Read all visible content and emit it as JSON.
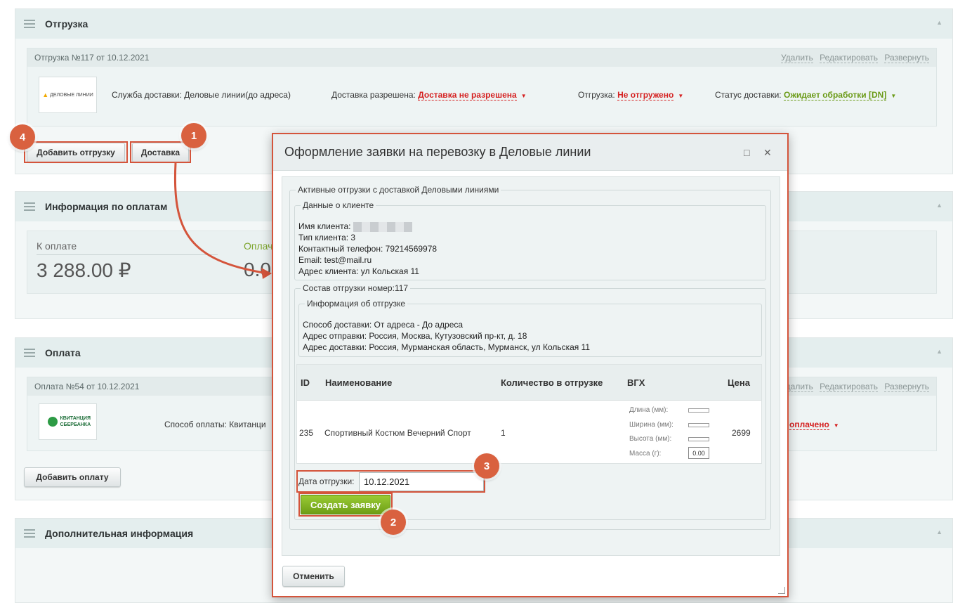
{
  "shipment_section": {
    "title": "Отгрузка",
    "card_title": "Отгрузка №117 от 10.12.2021",
    "links": [
      "Удалить",
      "Редактировать",
      "Развернуть"
    ],
    "logo_text": "ДЕЛОВЫЕ ЛИНИИ",
    "delivery_service_label": "Служба доставки:",
    "delivery_service_value": "Деловые линии(до адреса)",
    "delivery_allowed_label": "Доставка разрешена:",
    "delivery_allowed_value": "Доставка не разрешена",
    "shipment_label": "Отгрузка:",
    "shipment_value": "Не отгружено",
    "delivery_status_label": "Статус доставки:",
    "delivery_status_value": "Ожидает обработки [DN]",
    "add_shipment_button": "Добавить отгрузку",
    "delivery_button": "Доставка"
  },
  "payment_info_section": {
    "title": "Информация по оплатам",
    "to_pay_label": "К оплате",
    "to_pay_value": "3 288.00 ₽",
    "paid_label": "Оплач",
    "paid_value": "0.0"
  },
  "payment_section": {
    "title": "Оплата",
    "card_title": "Оплата №54 от 10.12.2021",
    "links": [
      "Удалить",
      "Редактировать",
      "Развернуть"
    ],
    "logo_text": "КВИТАНЦИЯ СБЕРБАНКА",
    "method_label": "Способ оплаты: Квитанци",
    "status_value": "оплачено",
    "add_payment_button": "Добавить оплату"
  },
  "extra_section": {
    "title": "Дополнительная информация"
  },
  "dialog": {
    "title": "Оформление заявки на перевозку в Деловые линии",
    "maximize_icon": "□",
    "close_icon": "✕",
    "active_legend": "Активные отгрузки с доставкой Деловыми линиями",
    "client_legend": "Данные о клиенте",
    "client_name": "Имя клиента:",
    "client_type": "Тип клиента: 3",
    "client_phone": "Контактный телефон: 79214569978",
    "client_email": "Email: test@mail.ru",
    "client_address": "Адрес клиента: ул Кольская 11",
    "composition_legend": "Состав отгрузки номер:117",
    "info_legend": "Информация об отгрузке",
    "delivery_method": "Способ доставки: От адреса - До адреса",
    "from_address": "Адрес отправки: Россия, Москва, Кутузовский пр-кт, д. 18",
    "to_address": "Адрес доставки: Россия, Мурманская область, Мурманск, ул Кольская 11",
    "table": {
      "headers": [
        "ID",
        "Наименование",
        "Количество в отгрузке",
        "ВГХ",
        "Цена"
      ],
      "row": {
        "id": "235",
        "name": "Спортивный Костюм Вечерний Спорт",
        "qty": "1",
        "price": "2699"
      },
      "dims": [
        "Длина (мм):",
        "Ширина (мм):",
        "Высота (мм):",
        "Масса (г):"
      ],
      "mass_value": "0.00"
    },
    "ship_date_label": "Дата отгрузки:",
    "ship_date_value": "10.12.2021",
    "create_button": "Создать заявку",
    "cancel_button": "Отменить"
  },
  "badges": [
    "1",
    "2",
    "3",
    "4"
  ],
  "colors": {
    "accent": "#d4543b",
    "red": "#d52121",
    "green": "#6a9a16"
  }
}
